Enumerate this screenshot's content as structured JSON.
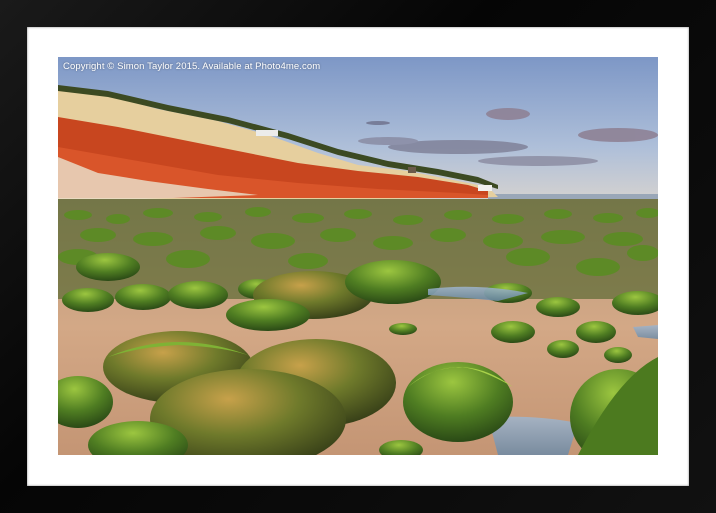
{
  "watermark": {
    "text": "Copyright © Simon Taylor 2015. Available at Photo4me.com"
  },
  "photo": {
    "subject": "striped cliffs and seaweed-covered boulders on beach at sunset"
  },
  "colors": {
    "frame": "#0a0a0a",
    "mount": "#ffffff",
    "sky": "#9fb3d4",
    "cliff_red": "#c9461e",
    "cliff_cream": "#e8d3a6",
    "sand": "#caa07a",
    "moss": "#5f8a2a"
  }
}
